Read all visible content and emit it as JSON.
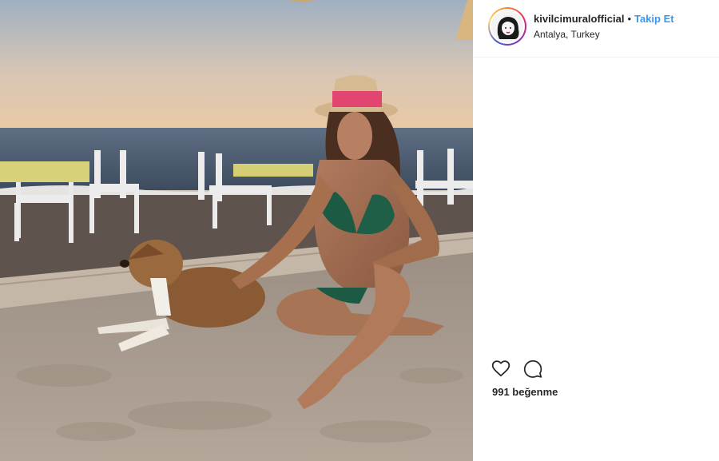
{
  "post": {
    "image_alt": "Woman in a straw hat and green bikini sitting on the sand petting a brown dog, beach tables and sea behind",
    "username": "kivilcimuralofficial",
    "separator": "•",
    "follow_label": "Takip Et",
    "location": "Antalya, Turkey",
    "likes_text": "991 beğenme"
  },
  "icons": {
    "like": "heart-icon",
    "comment": "comment-bubble-icon"
  },
  "colors": {
    "follow_link": "#3897f0",
    "text": "#262626",
    "divider": "#efefef"
  }
}
